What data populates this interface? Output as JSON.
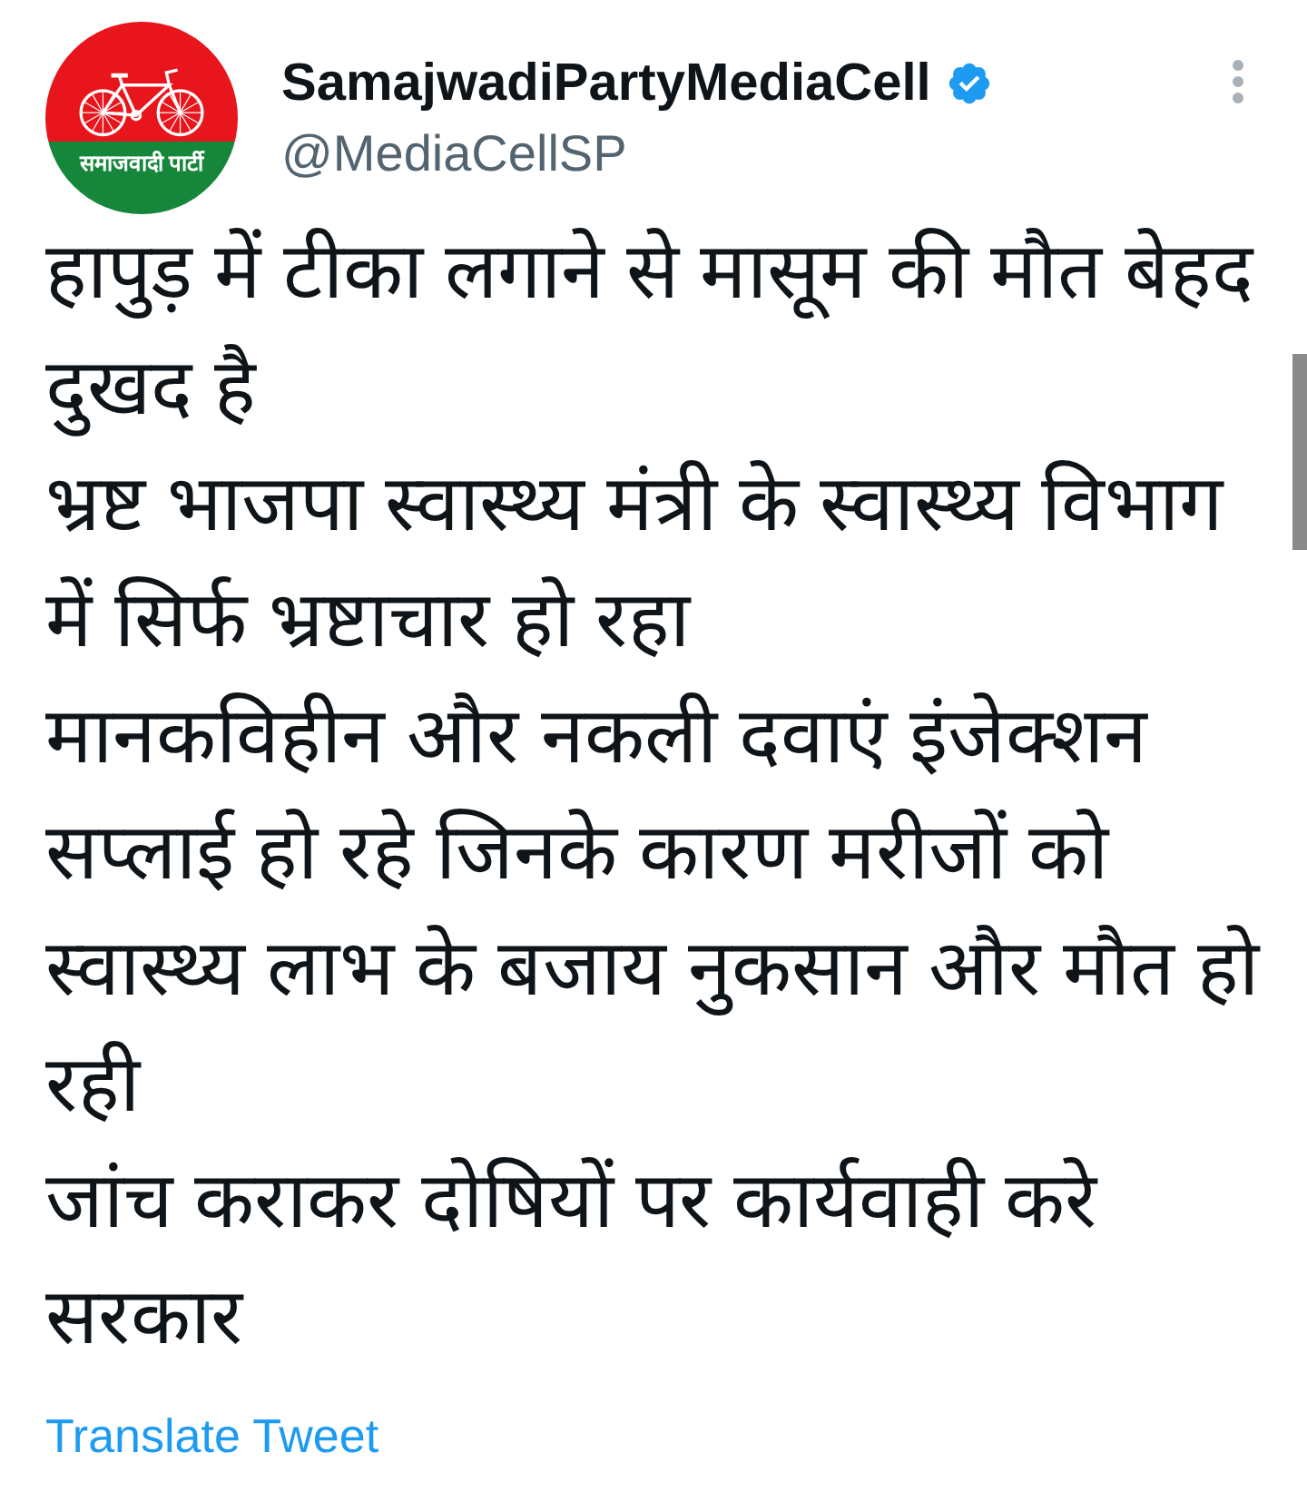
{
  "account": {
    "avatar": {
      "logo_text": "समाजवादी पार्टी"
    },
    "name": "SamajwadiPartyMediaCell",
    "verified": true,
    "handle": "@MediaCellSP"
  },
  "tweet": {
    "paragraphs": [
      "हापुड़ में टीका लगाने से मासूम की मौत बेहद दुखद है",
      "भ्रष्ट भाजपा स्वास्थ्य मंत्री के स्वास्थ्य विभाग में सिर्फ भ्रष्टाचार हो रहा",
      "मानकविहीन और नकली दवाएं इंजेक्शन सप्लाई हो रहे जिनके कारण मरीजों को स्वास्थ्य लाभ के बजाय नुकसान और मौत हो रही",
      "जांच कराकर दोषियों पर कार्यवाही करे सरकार"
    ]
  },
  "translate_link": "Translate Tweet"
}
